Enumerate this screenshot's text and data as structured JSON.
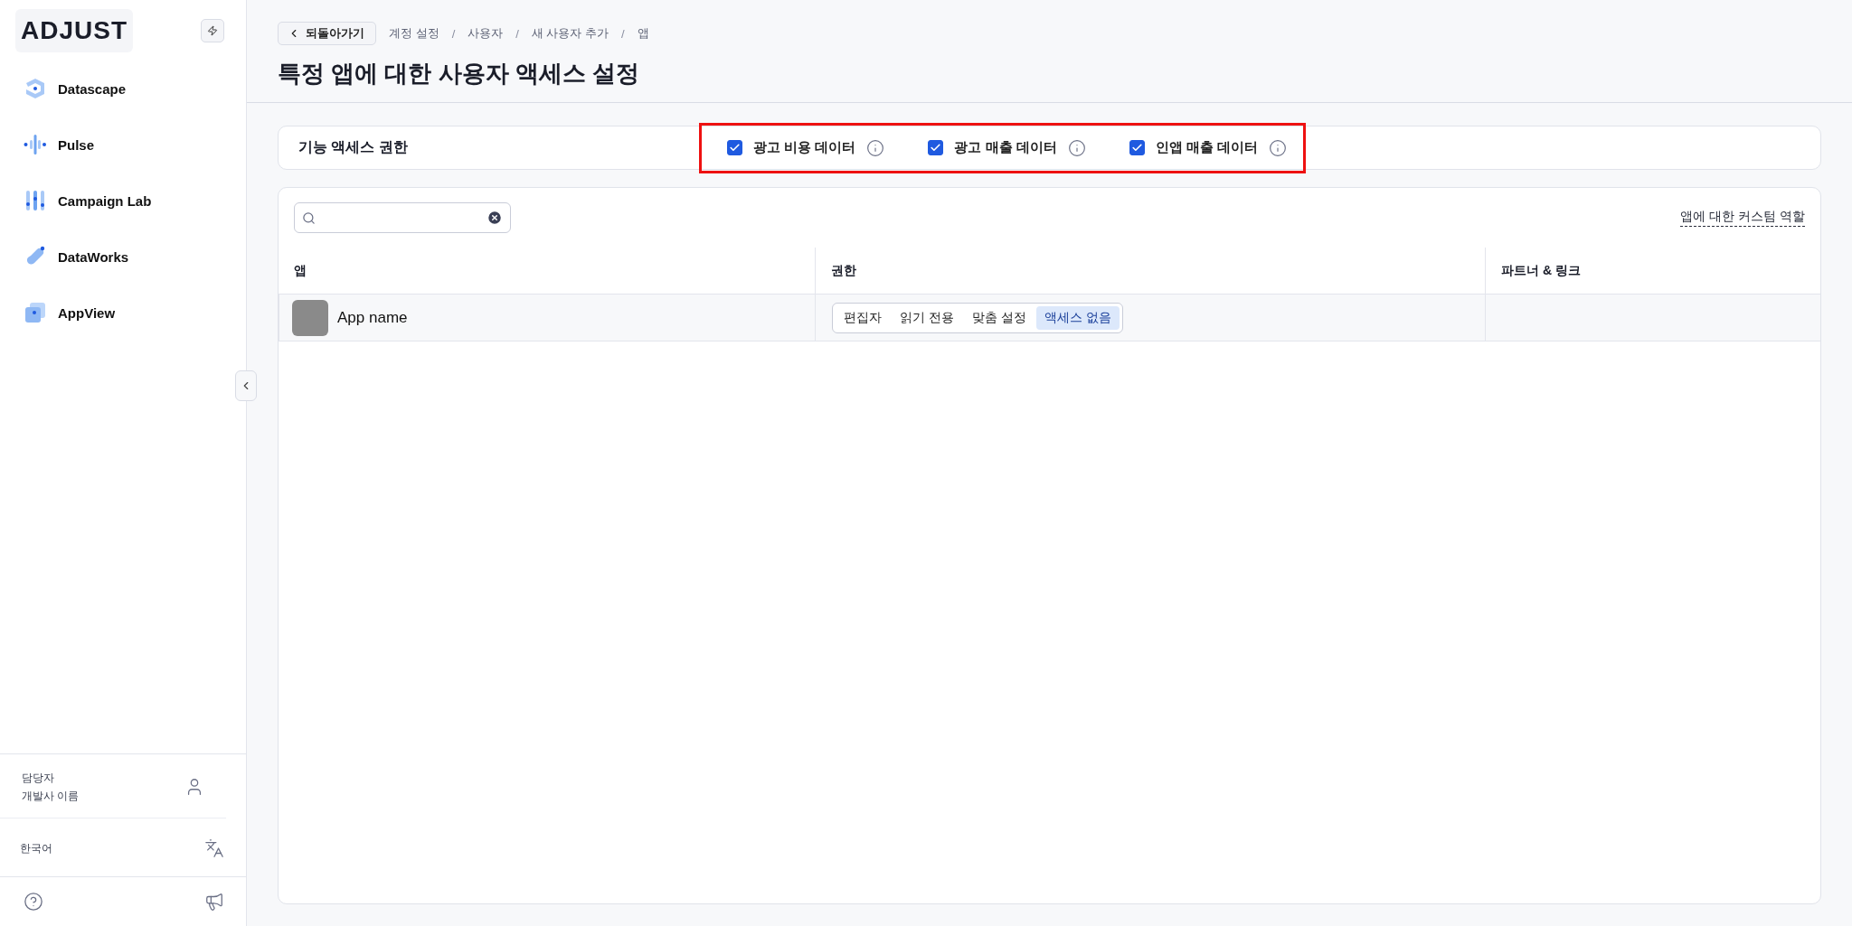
{
  "sidebar": {
    "logo": "ADJUST",
    "products": [
      {
        "label": "Datascape",
        "kind": "datascape"
      },
      {
        "label": "Pulse",
        "kind": "pulse"
      },
      {
        "label": "Campaign Lab",
        "kind": "campaign"
      },
      {
        "label": "DataWorks",
        "kind": "dataworks"
      },
      {
        "label": "AppView",
        "kind": "appview"
      }
    ],
    "user": {
      "role": "담당자",
      "name": "개발사 이름"
    },
    "language": "한국어"
  },
  "header": {
    "back_button": "되돌아가기",
    "breadcrumb": [
      "계정 설정",
      "사용자",
      "새 사용자 추가",
      "앱"
    ],
    "breadcrumb_separator": "/",
    "title": "특정 앱에 대한 사용자 액세스 설정"
  },
  "features": {
    "label": "기능 액세스 권한",
    "highlighted": true,
    "options": [
      {
        "label": "광고 비용 데이터",
        "checked": true
      },
      {
        "label": "광고 매출 데이터",
        "checked": true
      },
      {
        "label": "인앱 매출 데이터",
        "checked": true
      }
    ]
  },
  "table": {
    "custom_roles_link": "앱에 대한 커스텀 역할",
    "columns": [
      "앱",
      "권한",
      "파트너 & 링크"
    ],
    "rows": [
      {
        "app": "App name",
        "permissions": [
          {
            "label": "편집자",
            "selected": false
          },
          {
            "label": "읽기 전용",
            "selected": false
          },
          {
            "label": "맞춤 설정",
            "selected": false
          },
          {
            "label": "액세스 없음",
            "selected": true
          }
        ]
      }
    ]
  }
}
